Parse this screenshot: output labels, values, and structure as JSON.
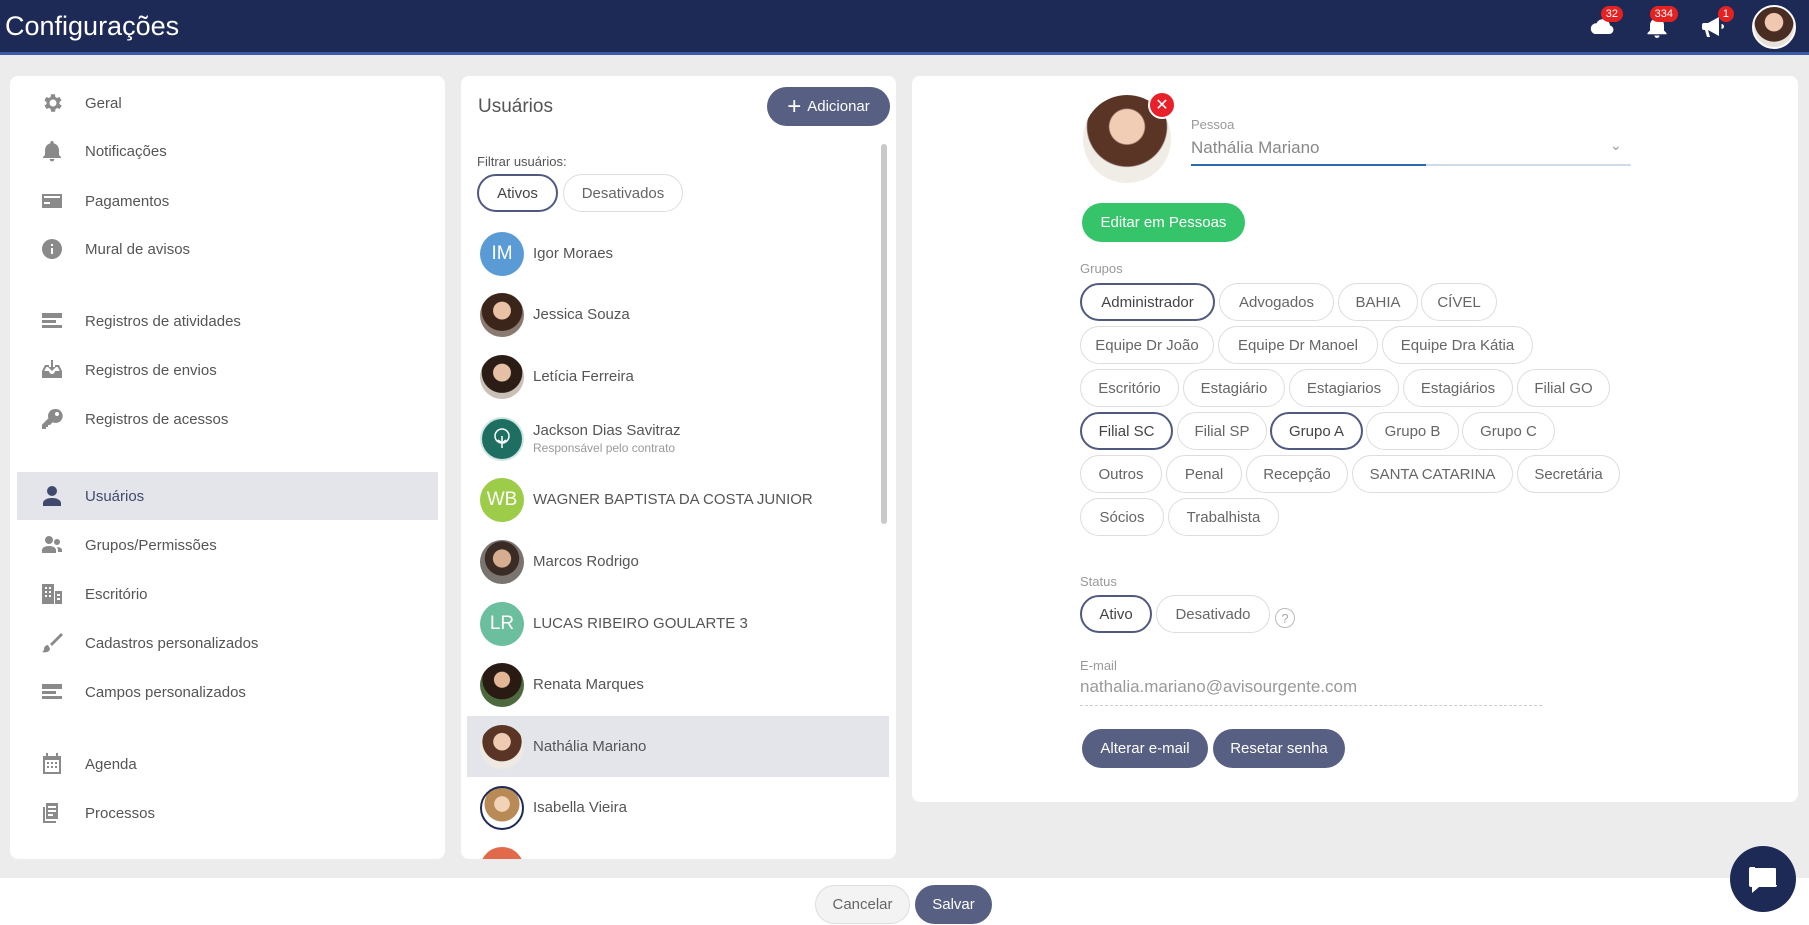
{
  "header": {
    "title": "Configurações",
    "cloud_badge": "32",
    "bell_badge": "334",
    "megaphone_badge": "1"
  },
  "sidebar": {
    "items": [
      {
        "label": "Geral",
        "icon": "gear-icon"
      },
      {
        "label": "Notificações",
        "icon": "bell-icon"
      },
      {
        "label": "Pagamentos",
        "icon": "credit-card-icon"
      },
      {
        "label": "Mural de avisos",
        "icon": "info-icon"
      },
      {
        "label": "Registros de atividades",
        "icon": "list-icon"
      },
      {
        "label": "Registros de envios",
        "icon": "inbox-icon"
      },
      {
        "label": "Registros de acessos",
        "icon": "key-icon"
      },
      {
        "label": "Usuários",
        "icon": "user-icon"
      },
      {
        "label": "Grupos/Permissões",
        "icon": "users-icon"
      },
      {
        "label": "Escritório",
        "icon": "building-icon"
      },
      {
        "label": "Cadastros personalizados",
        "icon": "brush-icon"
      },
      {
        "label": "Campos personalizados",
        "icon": "list-icon"
      },
      {
        "label": "Agenda",
        "icon": "calendar-icon"
      },
      {
        "label": "Processos",
        "icon": "document-icon"
      }
    ]
  },
  "users_panel": {
    "title": "Usuários",
    "add_label": "Adicionar",
    "filter_label": "Filtrar usuários:",
    "filters": [
      "Ativos",
      "Desativados"
    ],
    "users": [
      {
        "name": "Igor Moraes",
        "initials": "IM",
        "subtitle": ""
      },
      {
        "name": "Jessica Souza",
        "initials": "",
        "subtitle": ""
      },
      {
        "name": "Letícia Ferreira",
        "initials": "",
        "subtitle": ""
      },
      {
        "name": "Jackson Dias Savitraz",
        "initials": "",
        "subtitle": "Responsável pelo contrato"
      },
      {
        "name": "WAGNER BAPTISTA DA COSTA JUNIOR",
        "initials": "WB",
        "subtitle": ""
      },
      {
        "name": "Marcos Rodrigo",
        "initials": "",
        "subtitle": ""
      },
      {
        "name": "LUCAS RIBEIRO GOULARTE 3",
        "initials": "LR",
        "subtitle": ""
      },
      {
        "name": "Renata Marques",
        "initials": "",
        "subtitle": ""
      },
      {
        "name": "Nathália Mariano",
        "initials": "",
        "subtitle": ""
      },
      {
        "name": "Isabella Vieira",
        "initials": "",
        "subtitle": ""
      }
    ]
  },
  "detail": {
    "person_label": "Pessoa",
    "person_value": "Nathália Mariano",
    "edit_label": "Editar em Pessoas",
    "groups_label": "Grupos",
    "groups": [
      [
        "Administrador",
        "Advogados",
        "BAHIA",
        "CÍVEL"
      ],
      [
        "Equipe Dr João",
        "Equipe Dr Manoel",
        "Equipe Dra Kátia"
      ],
      [
        "Escritório",
        "Estagiário",
        "Estagiarios",
        "Estagiários",
        "Filial GO"
      ],
      [
        "Filial SC",
        "Filial SP",
        "Grupo A",
        "Grupo B",
        "Grupo C"
      ],
      [
        "Outros",
        "Penal",
        "Recepção",
        "SANTA CATARINA",
        "Secretária"
      ],
      [
        "Sócios",
        "Trabalhista"
      ]
    ],
    "status_label": "Status",
    "status_options": [
      "Ativo",
      "Desativado"
    ],
    "email_label": "E-mail",
    "email_value": "nathalia.mariano@avisourgente.com",
    "change_email_label": "Alterar e-mail",
    "reset_password_label": "Resetar senha"
  },
  "footer": {
    "cancel_label": "Cancelar",
    "save_label": "Salvar"
  }
}
